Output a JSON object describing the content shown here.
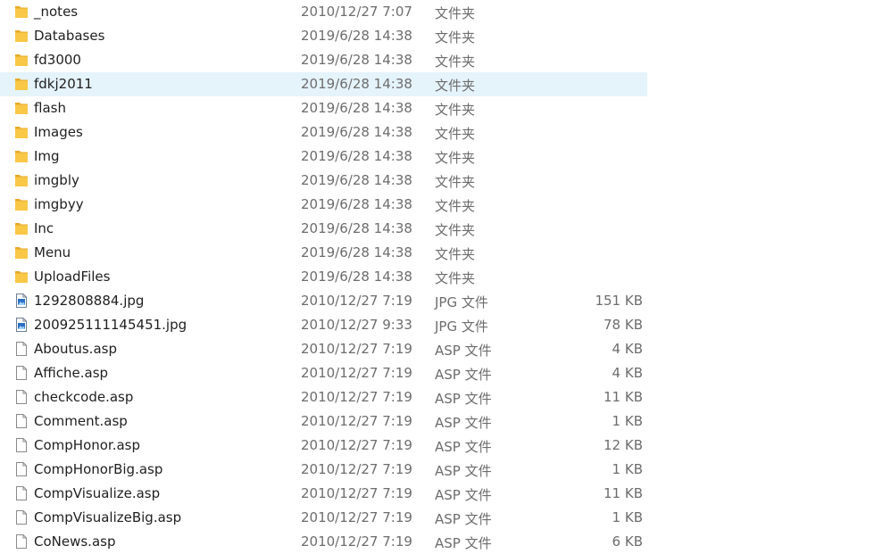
{
  "colors": {
    "selected_row": "#e5f3fb",
    "folder": "#f8c846",
    "text_primary": "#1f1f1f",
    "text_secondary": "#6d6d6d"
  },
  "file_list": {
    "rows": [
      {
        "name": "_notes",
        "date": "2010/12/27 7:07",
        "type": "文件夹",
        "size": "",
        "icon": "folder-icon",
        "selected": false
      },
      {
        "name": "Databases",
        "date": "2019/6/28 14:38",
        "type": "文件夹",
        "size": "",
        "icon": "folder-icon",
        "selected": false
      },
      {
        "name": "fd3000",
        "date": "2019/6/28 14:38",
        "type": "文件夹",
        "size": "",
        "icon": "folder-icon",
        "selected": false
      },
      {
        "name": "fdkj2011",
        "date": "2019/6/28 14:38",
        "type": "文件夹",
        "size": "",
        "icon": "folder-icon",
        "selected": true
      },
      {
        "name": "flash",
        "date": "2019/6/28 14:38",
        "type": "文件夹",
        "size": "",
        "icon": "folder-icon",
        "selected": false
      },
      {
        "name": "Images",
        "date": "2019/6/28 14:38",
        "type": "文件夹",
        "size": "",
        "icon": "folder-icon",
        "selected": false
      },
      {
        "name": "Img",
        "date": "2019/6/28 14:38",
        "type": "文件夹",
        "size": "",
        "icon": "folder-icon",
        "selected": false
      },
      {
        "name": "imgbly",
        "date": "2019/6/28 14:38",
        "type": "文件夹",
        "size": "",
        "icon": "folder-icon",
        "selected": false
      },
      {
        "name": "imgbyy",
        "date": "2019/6/28 14:38",
        "type": "文件夹",
        "size": "",
        "icon": "folder-icon",
        "selected": false
      },
      {
        "name": "Inc",
        "date": "2019/6/28 14:38",
        "type": "文件夹",
        "size": "",
        "icon": "folder-icon",
        "selected": false
      },
      {
        "name": "Menu",
        "date": "2019/6/28 14:38",
        "type": "文件夹",
        "size": "",
        "icon": "folder-icon",
        "selected": false
      },
      {
        "name": "UploadFiles",
        "date": "2019/6/28 14:38",
        "type": "文件夹",
        "size": "",
        "icon": "folder-icon",
        "selected": false
      },
      {
        "name": "1292808884.jpg",
        "date": "2010/12/27 7:19",
        "type": "JPG 文件",
        "size": "151 KB",
        "icon": "image-file-icon",
        "selected": false
      },
      {
        "name": "200925111145451.jpg",
        "date": "2010/12/27 9:33",
        "type": "JPG 文件",
        "size": "78 KB",
        "icon": "image-file-icon",
        "selected": false
      },
      {
        "name": "Aboutus.asp",
        "date": "2010/12/27 7:19",
        "type": "ASP 文件",
        "size": "4 KB",
        "icon": "document-icon",
        "selected": false
      },
      {
        "name": "Affiche.asp",
        "date": "2010/12/27 7:19",
        "type": "ASP 文件",
        "size": "4 KB",
        "icon": "document-icon",
        "selected": false
      },
      {
        "name": "checkcode.asp",
        "date": "2010/12/27 7:19",
        "type": "ASP 文件",
        "size": "11 KB",
        "icon": "document-icon",
        "selected": false
      },
      {
        "name": "Comment.asp",
        "date": "2010/12/27 7:19",
        "type": "ASP 文件",
        "size": "1 KB",
        "icon": "document-icon",
        "selected": false
      },
      {
        "name": "CompHonor.asp",
        "date": "2010/12/27 7:19",
        "type": "ASP 文件",
        "size": "12 KB",
        "icon": "document-icon",
        "selected": false
      },
      {
        "name": "CompHonorBig.asp",
        "date": "2010/12/27 7:19",
        "type": "ASP 文件",
        "size": "1 KB",
        "icon": "document-icon",
        "selected": false
      },
      {
        "name": "CompVisualize.asp",
        "date": "2010/12/27 7:19",
        "type": "ASP 文件",
        "size": "11 KB",
        "icon": "document-icon",
        "selected": false
      },
      {
        "name": "CompVisualizeBig.asp",
        "date": "2010/12/27 7:19",
        "type": "ASP 文件",
        "size": "1 KB",
        "icon": "document-icon",
        "selected": false
      },
      {
        "name": "CoNews.asp",
        "date": "2010/12/27 7:19",
        "type": "ASP 文件",
        "size": "6 KB",
        "icon": "document-icon",
        "selected": false
      }
    ]
  }
}
